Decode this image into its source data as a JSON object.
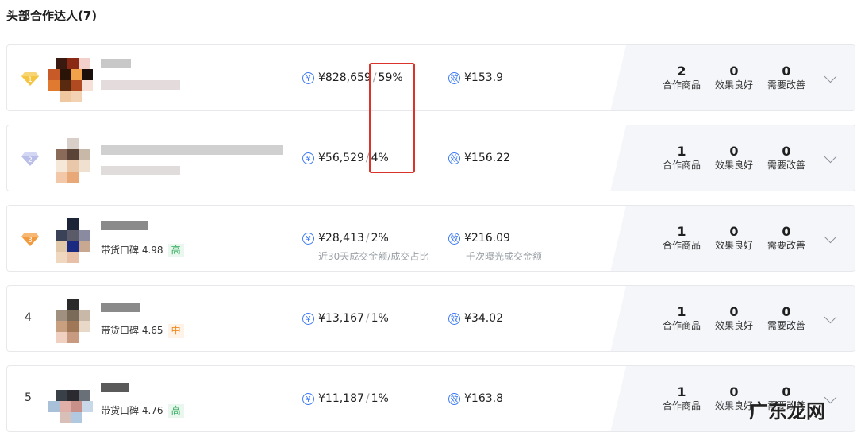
{
  "section": {
    "title": "头部合作达人(7)"
  },
  "stat_labels": {
    "products": "合作商品",
    "good": "效果良好",
    "improve": "需要改善"
  },
  "column_sublabels": {
    "gmv": "近30天成交金额/成交占比",
    "efficiency": "千次曝光成交金额"
  },
  "rows": [
    {
      "rank": "1",
      "gmv": "¥828,659",
      "share": "59%",
      "eff": "¥153.9",
      "products": "2",
      "good": "0",
      "improve": "0"
    },
    {
      "rank": "2",
      "gmv": "¥56,529",
      "share": "4%",
      "eff": "¥156.22",
      "products": "1",
      "good": "0",
      "improve": "0"
    },
    {
      "rank": "3",
      "rating_label": "带货口碑",
      "rating": "4.98",
      "rating_level": "高",
      "gmv": "¥28,413",
      "share": "2%",
      "eff": "¥216.09",
      "products": "1",
      "good": "0",
      "improve": "0"
    },
    {
      "rank": "4",
      "rating_label": "带货口碑",
      "rating": "4.65",
      "rating_level": "中",
      "gmv": "¥13,167",
      "share": "1%",
      "eff": "¥34.02",
      "products": "1",
      "good": "0",
      "improve": "0"
    },
    {
      "rank": "5",
      "rating_label": "带货口碑",
      "rating": "4.76",
      "rating_level": "高",
      "gmv": "¥11,187",
      "share": "1%",
      "eff": "¥163.8",
      "products": "1",
      "good": "0",
      "improve": "0"
    }
  ],
  "icons": {
    "money": "yuan-circle-icon",
    "efficiency": "efficiency-circle-icon",
    "expand": "chevron-down-icon",
    "badge": "diamond-rank-icon"
  },
  "colors": {
    "gold": "#f2b533",
    "silver": "#b7bde8",
    "bronze": "#f2a04a",
    "accent": "#3c79f2",
    "highlight": "#d9332b"
  },
  "site_watermark": "广东龙网"
}
